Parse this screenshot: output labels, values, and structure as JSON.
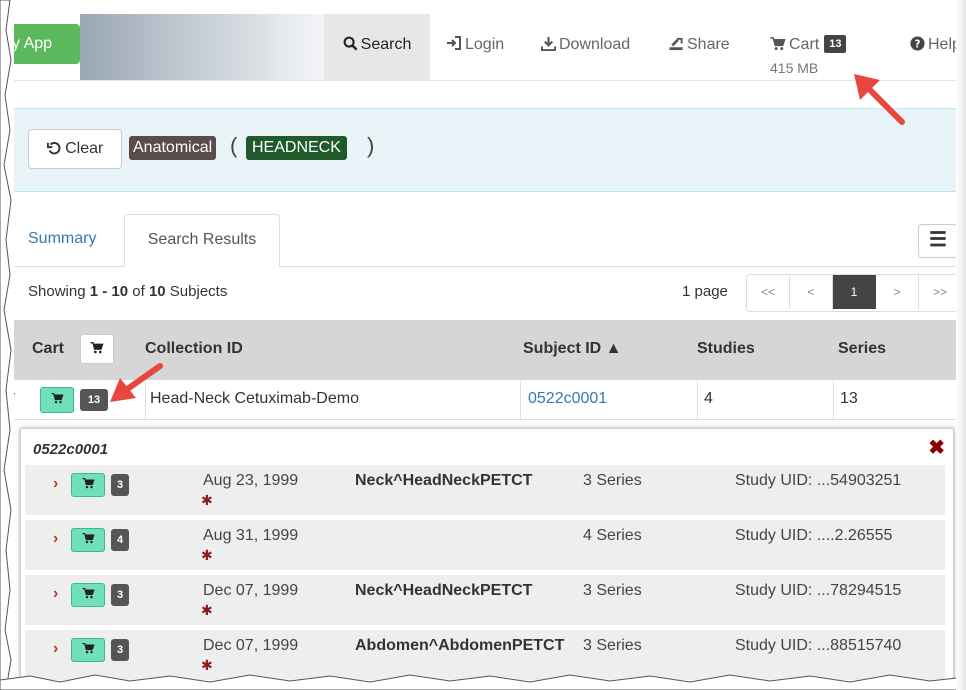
{
  "nav": {
    "brand": "y App",
    "search": "Search",
    "login": "Login",
    "download": "Download",
    "share": "Share",
    "cart": "Cart",
    "cart_count": "13",
    "cart_size": "415 MB",
    "help": "Help"
  },
  "filter": {
    "clear": "Clear",
    "category": "Anatomical",
    "value": "HEADNECK",
    "open_paren": "(",
    "close_paren": ")"
  },
  "tabs": {
    "summary": "Summary",
    "results": "Search Results"
  },
  "results": {
    "showing_prefix": "Showing ",
    "range": "1 - 10",
    "of": " of ",
    "total": "10",
    "suffix": " Subjects",
    "pages_label": "1 page",
    "pager": [
      "<<",
      "<",
      "1",
      ">",
      ">>"
    ]
  },
  "table": {
    "headers": {
      "cart": "Cart",
      "collection": "Collection ID",
      "subject": "Subject ID ▲",
      "studies": "Studies",
      "series": "Series"
    },
    "row": {
      "count": "13",
      "collection": "Head-Neck Cetuximab-Demo",
      "subject": "0522c0001",
      "studies": "4",
      "series": "13"
    }
  },
  "detail": {
    "title": "0522c0001",
    "studies": [
      {
        "count": "3",
        "date": "Aug 23, 1999",
        "desc": "Neck^HeadNeckPETCT",
        "series": "3 Series",
        "uid": "Study UID: ...54903251"
      },
      {
        "count": "4",
        "date": "Aug 31, 1999",
        "desc": "",
        "series": "4 Series",
        "uid": "Study UID: ....2.26555"
      },
      {
        "count": "3",
        "date": "Dec 07, 1999",
        "desc": "Neck^HeadNeckPETCT",
        "series": "3 Series",
        "uid": "Study UID: ...78294515"
      },
      {
        "count": "3",
        "date": "Dec 07, 1999",
        "desc": "Abdomen^AbdomenPETCT",
        "series": "3 Series",
        "uid": "Study UID: ...88515740"
      }
    ]
  },
  "colors": {
    "brand_green": "#5cb85c",
    "cart_green": "#6fe0b9",
    "arrow_red": "#e8473f",
    "tag_dark_green": "#1e5a2a"
  }
}
